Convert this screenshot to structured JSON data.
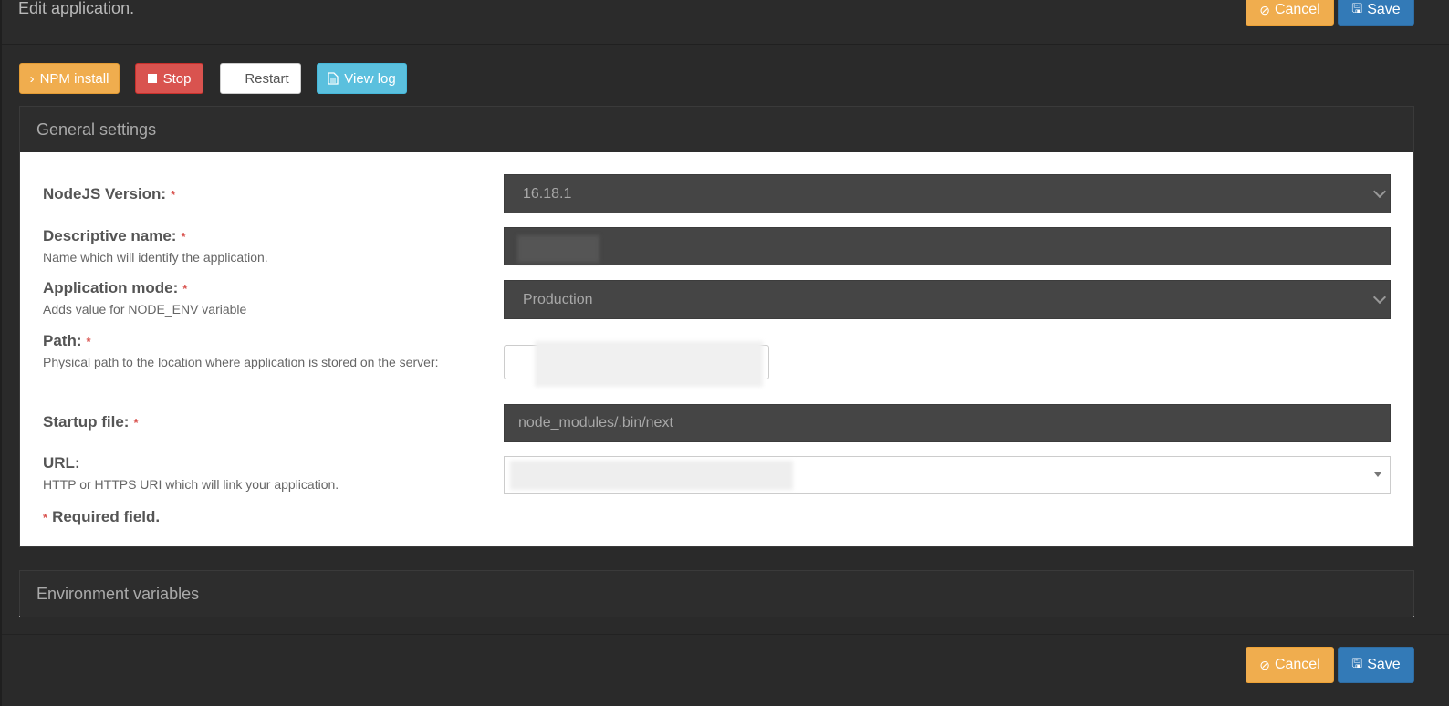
{
  "header": {
    "title": "Edit application."
  },
  "actions": {
    "cancel_label": "Cancel",
    "save_label": "Save"
  },
  "toolbar": {
    "npm_install_label": "NPM install",
    "stop_label": "Stop",
    "restart_label": "Restart",
    "view_log_label": "View log"
  },
  "general": {
    "heading": "General settings",
    "nodejs_version": {
      "label": "NodeJS Version:",
      "value": "16.18.1"
    },
    "descriptive_name": {
      "label": "Descriptive name:",
      "help": "Name which will identify the application."
    },
    "application_mode": {
      "label": "Application mode:",
      "help": "Adds value for NODE_ENV variable",
      "value": "Production"
    },
    "path": {
      "label": "Path:",
      "help": "Physical path to the location where application is stored on the server:"
    },
    "startup_file": {
      "label": "Startup file:",
      "value": "node_modules/.bin/next"
    },
    "url": {
      "label": "URL:",
      "help": "HTTP or HTTPS URI which will link your application."
    },
    "required_star": "*",
    "required_note": "Required field."
  },
  "env": {
    "heading": "Environment variables"
  },
  "colors": {
    "warning": "#f0ad4e",
    "primary": "#337ab7",
    "danger": "#d9534f",
    "info": "#5bc0de"
  }
}
